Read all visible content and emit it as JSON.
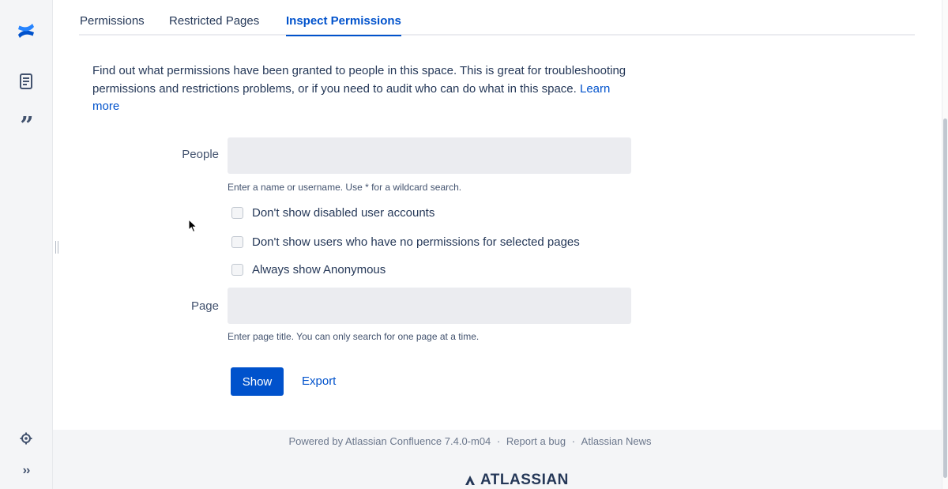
{
  "tabs": [
    {
      "label": "Permissions"
    },
    {
      "label": "Restricted Pages"
    },
    {
      "label": "Inspect Permissions"
    }
  ],
  "intro": {
    "text": "Find out what permissions have been granted to people in this space. This is great for troubleshooting permissions and restrictions problems, or if you need to audit who can do what in this space.",
    "learn_more": "Learn more"
  },
  "form": {
    "people_label": "People",
    "people_value": "",
    "people_hint": "Enter a name or username. Use * for a wildcard search.",
    "checkboxes": [
      {
        "label": "Don't show disabled user accounts",
        "checked": false
      },
      {
        "label": "Don't show users who have no permissions for selected pages",
        "checked": false
      },
      {
        "label": "Always show Anonymous",
        "checked": false
      }
    ],
    "page_label": "Page",
    "page_value": "",
    "page_hint": "Enter page title. You can only search for one page at a time.",
    "show_button": "Show",
    "export_link": "Export"
  },
  "footer": {
    "powered_by": "Powered by Atlassian Confluence 7.4.0-m04",
    "separator": "·",
    "report_bug": "Report a bug",
    "news": "Atlassian News",
    "brand": "ATLASSIAN"
  },
  "colors": {
    "accent": "#0052CC",
    "text": "#253858",
    "rail": "#F4F5F7"
  },
  "icons": {
    "logo": "confluence-logo-icon",
    "pages": "pages-icon",
    "blog": "blog-quote-icon",
    "settings": "settings-gear-icon",
    "expand": "expand-sidebar-icon"
  }
}
